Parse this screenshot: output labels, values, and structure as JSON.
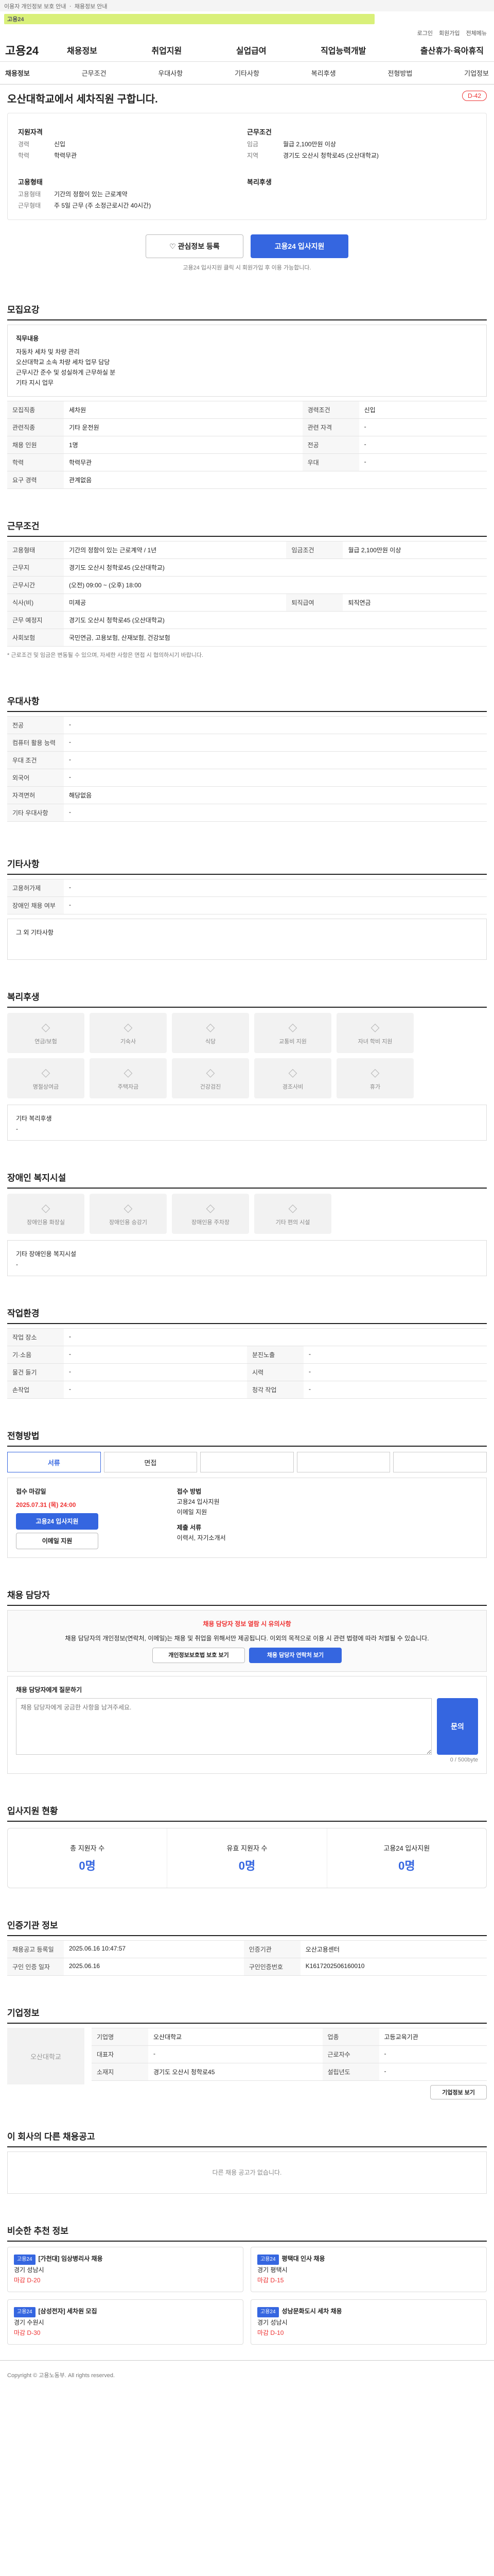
{
  "notice": "이용자 개인정보 보호 안내 ㆍ 채용정보 안내",
  "logo_text": "고용24",
  "util": [
    "로그인",
    "회원가입",
    "전체메뉴"
  ],
  "brand": "고용24",
  "gnb": [
    "채용정보",
    "취업지원",
    "실업급여",
    "직업능력개발",
    "출산휴가·육아휴직"
  ],
  "lnb": [
    "채용정보",
    "근무조건",
    "우대사항",
    "기타사항",
    "복리후생",
    "전형방법",
    "기업정보"
  ],
  "hero": {
    "title": "오산대학교에서 세차직원 구합니다.",
    "dday": "D-42"
  },
  "summary": {
    "left_title": "지원자격",
    "left": [
      [
        "경력",
        "신입"
      ],
      [
        "학력",
        "학력무관"
      ]
    ],
    "left_title2": "고용형태",
    "left2": [
      [
        "고용형태",
        "기간의 정함이 있는 근로계약"
      ],
      [
        "근무형태",
        "주 5일 근무 (주 소정근로시간 40시간)"
      ]
    ],
    "right_title": "근무조건",
    "right": [
      [
        "임금",
        "월급 2,100만원 이상"
      ],
      [
        "지역",
        "경기도 오산시 청학로45 (오산대학교)"
      ]
    ],
    "right_title2": "복리후생"
  },
  "buttons": {
    "scrap": "관심정보 등록",
    "apply": "고용24 입사지원"
  },
  "apply_note": "고용24 입사지원 클릭 시 회원가입 후 이용 가능합니다.",
  "recruit": {
    "title": "모집요강",
    "duty_label": "직무내용",
    "duty": "자동차 세차 및 차량 관리\n오산대학교 소속 차량 세차 업무 담당\n근무시간 준수 및 성실하게 근무하실 분\n기타 지시 업무",
    "rows": [
      [
        "모집직종",
        "세차원",
        "경력조건",
        "신입"
      ],
      [
        "관련직종",
        "기타 운전원",
        "관련 자격",
        "-"
      ],
      [
        "채용 인원",
        "1명",
        "전공",
        "-"
      ],
      [
        "학력",
        "학력무관",
        "우대",
        "-"
      ],
      [
        "요구 경력",
        "관계없음",
        "",
        ""
      ]
    ]
  },
  "cond": {
    "title": "근무조건",
    "rows": [
      [
        "고용형태",
        "기간의 정함이 있는 근로계약 / 1년",
        "임금조건",
        "월급 2,100만원 이상"
      ],
      [
        "근무지",
        "경기도 오산시 청학로45 (오산대학교)",
        "",
        ""
      ],
      [
        "근무시간",
        "(오전) 09:00 ~ (오후) 18:00",
        "",
        ""
      ],
      [
        "식사(비)",
        "미제공",
        "퇴직급여",
        "퇴직연금"
      ],
      [
        "근무 예정지",
        "경기도 오산시 청학로45 (오산대학교)",
        "",
        ""
      ],
      [
        "사회보험",
        "국민연금, 고용보험, 산재보험, 건강보험",
        "",
        ""
      ]
    ],
    "note": "* 근로조건 및 임금은 변동될 수 있으며, 자세한 사항은 면접 시 협의하시기 바랍니다."
  },
  "pref": {
    "title": "우대사항",
    "rows": [
      [
        "전공",
        "-"
      ],
      [
        "컴퓨터 활용 능력",
        "-"
      ],
      [
        "우대 조건",
        "-"
      ],
      [
        "외국어",
        "-"
      ],
      [
        "자격면허",
        "해당없음"
      ],
      [
        "기타 우대사항",
        "-"
      ]
    ]
  },
  "etc": {
    "title": "기타사항",
    "rows": [
      [
        "고용허가제",
        "-"
      ],
      [
        "장애인 채용 여부",
        "-"
      ]
    ],
    "box": "그 외 기타사항"
  },
  "welfare": {
    "title": "복리후생",
    "items": [
      "연금/보험",
      "기숙사",
      "식당",
      "교통비 지원",
      "자녀 학비 지원",
      "명절상여금",
      "주택자금",
      "건강검진",
      "경조사비",
      "휴가"
    ],
    "extra_label": "기타 복리후생",
    "extra": "-"
  },
  "disability": {
    "title": "장애인 복지시설",
    "items": [
      "장애인용 화장실",
      "장애인용 승강기",
      "장애인용 주차장",
      "기타 편의 시설"
    ],
    "extra_label": "기타 장애인용 복지시설",
    "extra": "-"
  },
  "place": {
    "title": "작업환경",
    "rows": [
      [
        "작업 장소",
        "-",
        "",
        ""
      ],
      [
        "기·소음",
        "-",
        "분진노출",
        "-"
      ],
      [
        "물건 들기",
        "-",
        "시력",
        "-"
      ],
      [
        "손작업",
        "-",
        "청각 작업",
        "-"
      ]
    ]
  },
  "process": {
    "title": "전형방법",
    "steps": [
      "서류",
      "면접",
      "",
      "",
      ""
    ],
    "period_label": "접수 마감일",
    "period": "2025.07.31 (목) 24:00",
    "method_label": "접수 방법",
    "methods": [
      "고용24 입사지원",
      "이메일 지원"
    ],
    "docs_label": "제출 서류",
    "docs": "이력서, 자기소개서",
    "btn1": "고용24 입사지원",
    "btn2": "이메일 지원"
  },
  "manager": {
    "title": "채용 담당자",
    "warn": "채용 담당자 정보 열람 시 유의사항",
    "warn_text": "채용 담당자의 개인정보(연락처, 이메일)는 채용 및 취업을 위해서만 제공됩니다. 이외의 목적으로 이용 시 관련 법령에 따라 처벌될 수 있습니다.",
    "btn1": "개인정보보호법 보호 보기",
    "btn2": "채용 담당자 연락처 보기"
  },
  "inquiry": {
    "title": "채용 담당자에게 질문하기",
    "placeholder": "채용 담당자에게 궁금한 사항을 남겨주세요.",
    "count": "0 / 500byte",
    "submit": "문의"
  },
  "stats": {
    "title": "입사지원 현황",
    "items": [
      [
        "총 지원자 수",
        "0명"
      ],
      [
        "유효 지원자 수",
        "0명"
      ],
      [
        "고용24 입사지원",
        "0명"
      ]
    ]
  },
  "dates": {
    "title": "인증기관 정보",
    "rows": [
      [
        "채용공고 등록일",
        "2025.06.16 10:47:57",
        "인증기관",
        "오산고용센터"
      ],
      [
        "구인 인증 일자",
        "2025.06.16",
        "구인인증번호",
        "K1617202506160010"
      ]
    ]
  },
  "company": {
    "title": "기업정보",
    "name": "오산대학교",
    "rows": [
      [
        "기업명",
        "오산대학교",
        "업종",
        "고등교육기관"
      ],
      [
        "대표자",
        "-",
        "근로자수",
        "-"
      ],
      [
        "소재지",
        "경기도 오산시 청학로45",
        "설립년도",
        "-"
      ]
    ],
    "btn": "기업정보 보기"
  },
  "related": {
    "title": "이 회사의 다른 채용공고",
    "empty": "다른 채용 공고가 없습니다."
  },
  "similar": {
    "title": "비슷한 추천 정보",
    "cards": [
      [
        "고용24",
        "[가천대] 임상병리사 채용",
        "경기 성남시",
        "마감 D-20"
      ],
      [
        "고용24",
        "평택대 인사 채용",
        "경기 평택시",
        "마감 D-15"
      ],
      [
        "고용24",
        "[삼성전자] 세차원 모집",
        "경기 수원시",
        "마감 D-30"
      ],
      [
        "고용24",
        "성남문화도시 세차 채용",
        "경기 성남시",
        "마감 D-10"
      ]
    ]
  },
  "footer": "Copyright © 고용노동부. All rights reserved."
}
